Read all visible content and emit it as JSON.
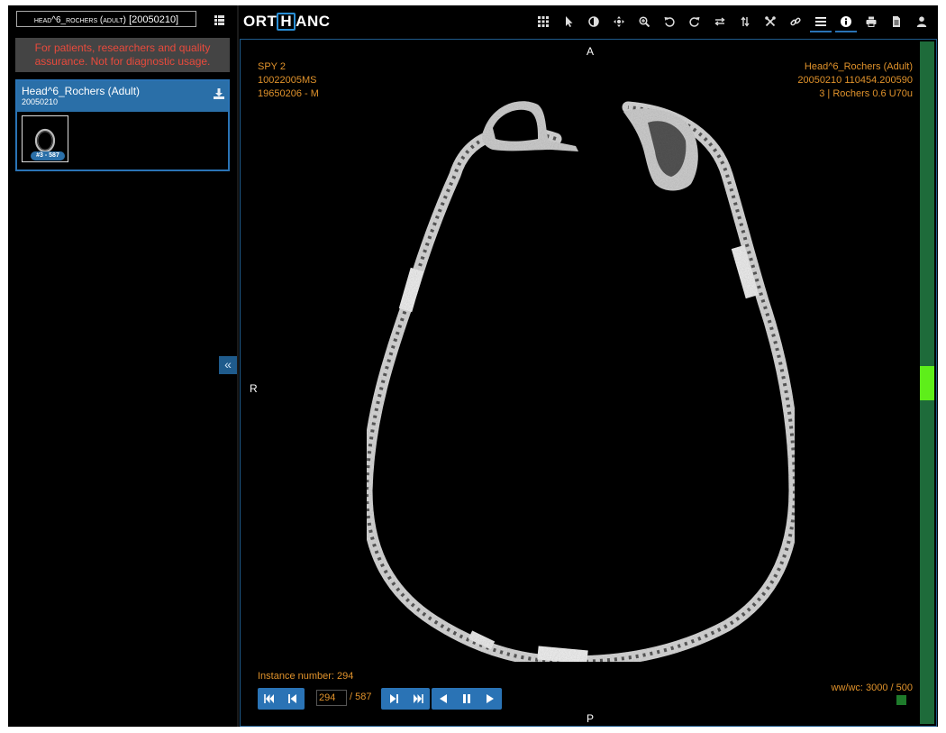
{
  "sidebar": {
    "study_selector": {
      "name": "head^6_rochers (adult)",
      "date": "[20050210]"
    },
    "warning": "For patients, researchers and quality assurance. Not for diagnostic usage.",
    "series": {
      "name": "Head^6_Rochers (Adult)",
      "date": "20050210",
      "thumbnail_badge": "#3 - 587"
    },
    "collapse_label": "«"
  },
  "toolbar": {
    "logo_left": "ORT",
    "logo_box": "H",
    "logo_right": "ANC",
    "tools": [
      "grid-layout-icon",
      "pointer-icon",
      "contrast-icon",
      "pan-icon",
      "zoom-icon",
      "rotate-left-icon",
      "rotate-right-icon",
      "flip-horizontal-icon",
      "flip-vertical-icon",
      "tools-icon",
      "link-icon",
      "menu-icon",
      "info-icon",
      "print-icon",
      "document-icon",
      "user-icon"
    ],
    "active_tools": [
      "menu-icon",
      "info-icon"
    ]
  },
  "viewer": {
    "top_left": [
      "SPY 2",
      "10022005MS",
      "19650206 - M"
    ],
    "top_right": [
      "Head^6_Rochers (Adult)",
      "20050210 110454.200590",
      "3 | Rochers 0.6 U70u"
    ],
    "instance_number": "Instance number: 294",
    "wwwc": "ww/wc: 3000 / 500",
    "orientation": {
      "top": "A",
      "left": "R",
      "bottom": "P"
    },
    "frame": {
      "current": "294",
      "total": "/ 587"
    },
    "scroll_position": 0.5,
    "accent_color": "#2a73b5",
    "overlay_color": "#e0922b"
  }
}
